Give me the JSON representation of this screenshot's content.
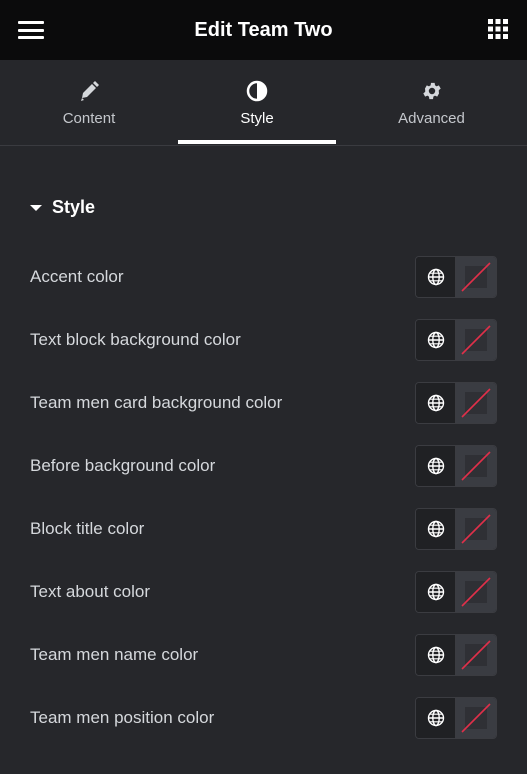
{
  "header": {
    "title": "Edit Team Two"
  },
  "tabs": [
    {
      "label": "Content",
      "icon": "pencil-icon"
    },
    {
      "label": "Style",
      "icon": "half-circle-icon",
      "active": true
    },
    {
      "label": "Advanced",
      "icon": "gear-icon"
    }
  ],
  "section": {
    "title": "Style"
  },
  "colors": {
    "no_color_slash": "#e0304a",
    "accent_header": "#0b0b0c"
  },
  "controls": [
    {
      "label": "Accent color"
    },
    {
      "label": "Text block background color"
    },
    {
      "label": "Team men card background color"
    },
    {
      "label": "Before background color"
    },
    {
      "label": "Block title color"
    },
    {
      "label": "Text about color"
    },
    {
      "label": "Team men name color"
    },
    {
      "label": "Team men position color"
    }
  ]
}
